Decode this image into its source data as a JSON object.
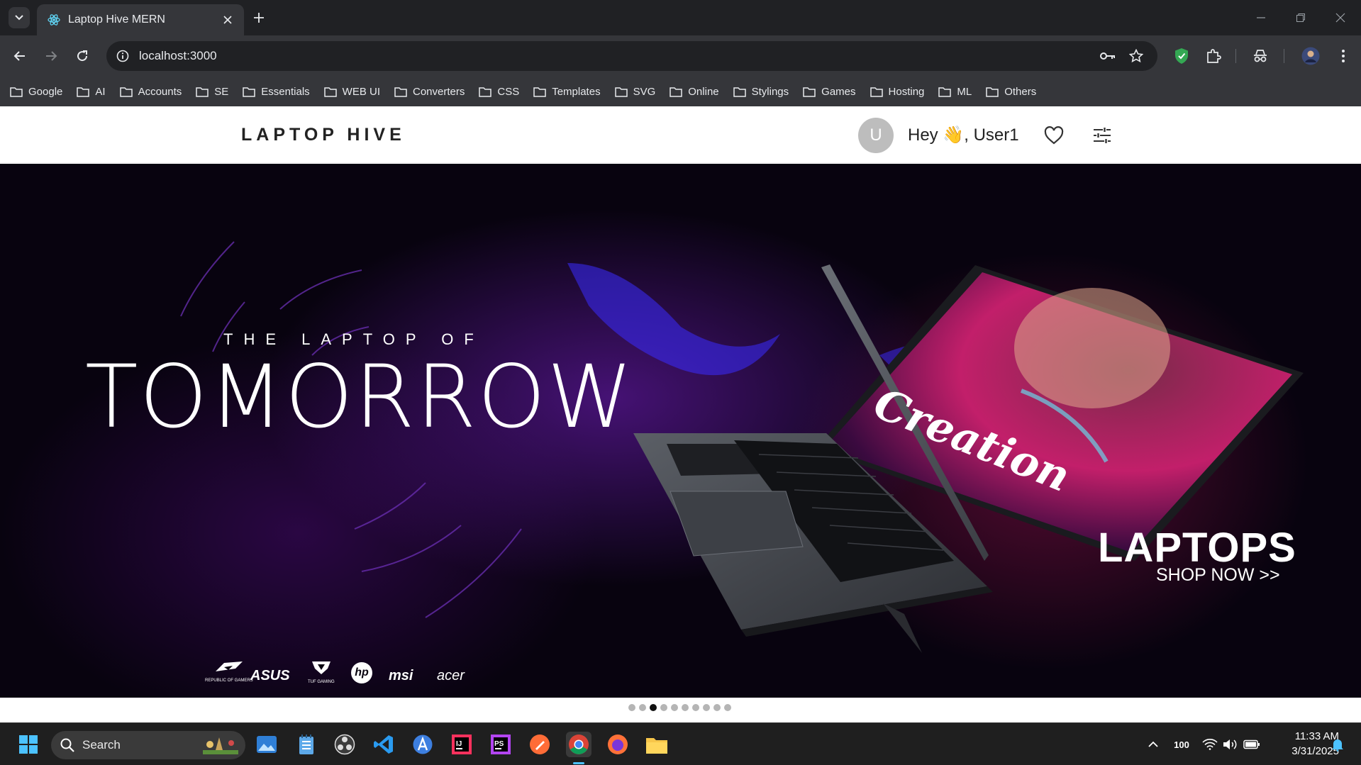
{
  "browser": {
    "tab_title": "Laptop Hive MERN",
    "url": "localhost:3000",
    "bookmarks": [
      "Google",
      "AI",
      "Accounts",
      "SE",
      "Essentials",
      "WEB UI",
      "Converters",
      "CSS",
      "Templates",
      "SVG",
      "Online",
      "Stylings",
      "Games",
      "Hosting",
      "ML",
      "Others"
    ]
  },
  "site": {
    "brand": "LAPTOP HIVE",
    "avatar_initial": "U",
    "greeting": "Hey 👋, User1"
  },
  "hero": {
    "kicker": "THE LAPTOP OF",
    "headline": "TOMORROW",
    "screen_text": "Creation",
    "category": "LAPTOPS",
    "cta": "SHOP NOW >>",
    "brand_logos": [
      "ROG",
      "ASUS",
      "TUF",
      "hp",
      "msi",
      "acer"
    ],
    "rog_caption": "REPUBLIC OF GAMERS",
    "tuf_caption": "TUF GAMING",
    "slide_count": 10,
    "active_slide": 3
  },
  "taskbar": {
    "search_label": "Search",
    "battery": "100",
    "time": "11:33 AM",
    "date": "3/31/2025"
  },
  "colors": {
    "chrome_dark": "#202124",
    "chrome_toolbar": "#35363a",
    "hero_bg": "#08030f",
    "accent_purple": "#7b2cff",
    "accent_pink": "#ff2f7a"
  }
}
